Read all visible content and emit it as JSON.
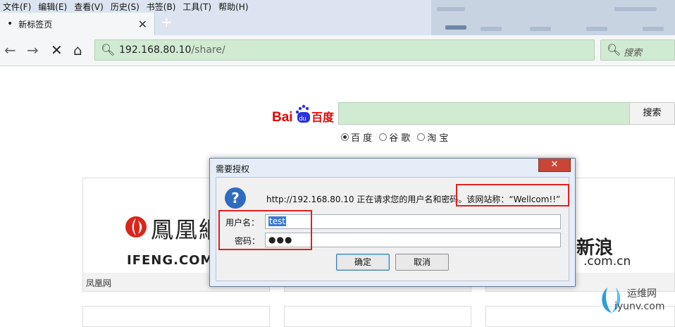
{
  "menu": [
    "文件(F)",
    "编辑(E)",
    "查看(V)",
    "历史(S)",
    "书签(B)",
    "工具(T)",
    "帮助(H)"
  ],
  "tab": {
    "label": "新标签页",
    "close": "✕",
    "new": "+"
  },
  "nav": {
    "back": "←",
    "forward": "→",
    "stop": "✕",
    "home": "⌂"
  },
  "url": {
    "host": "192.168.80.10",
    "path": "/share/"
  },
  "search": {
    "placeholder": "搜索"
  },
  "baidu": {
    "logo_bai": "Bai",
    "logo_du": "du",
    "logo_cn": "百度",
    "button": "搜索",
    "engines": [
      "百 度",
      "谷 歌",
      "淘 宝"
    ],
    "selected_engine": 0
  },
  "tiles": {
    "ifeng": {
      "word": "鳳凰網",
      "en": "IFENG.COM",
      "label": "凤凰网"
    },
    "sina": {
      "word": "新浪",
      "domain": ".com.cn"
    }
  },
  "dialog": {
    "title": "需要授权",
    "message": "http://192.168.80.10 正在请求您的用户名和密码。该网站称：“Wellcom!!”",
    "username_label": "用户名：",
    "username_value": "test",
    "password_label": "密码：",
    "password_value": "●●●",
    "ok": "确定",
    "cancel": "取消",
    "close": "✕"
  },
  "watermark": {
    "cn": "运维网",
    "en": "iyunv.com"
  },
  "colors": {
    "urlbar": "#d1ebd2",
    "annotation": "#e02020",
    "baidu_red": "#e10602",
    "baidu_blue": "#2932e1"
  }
}
